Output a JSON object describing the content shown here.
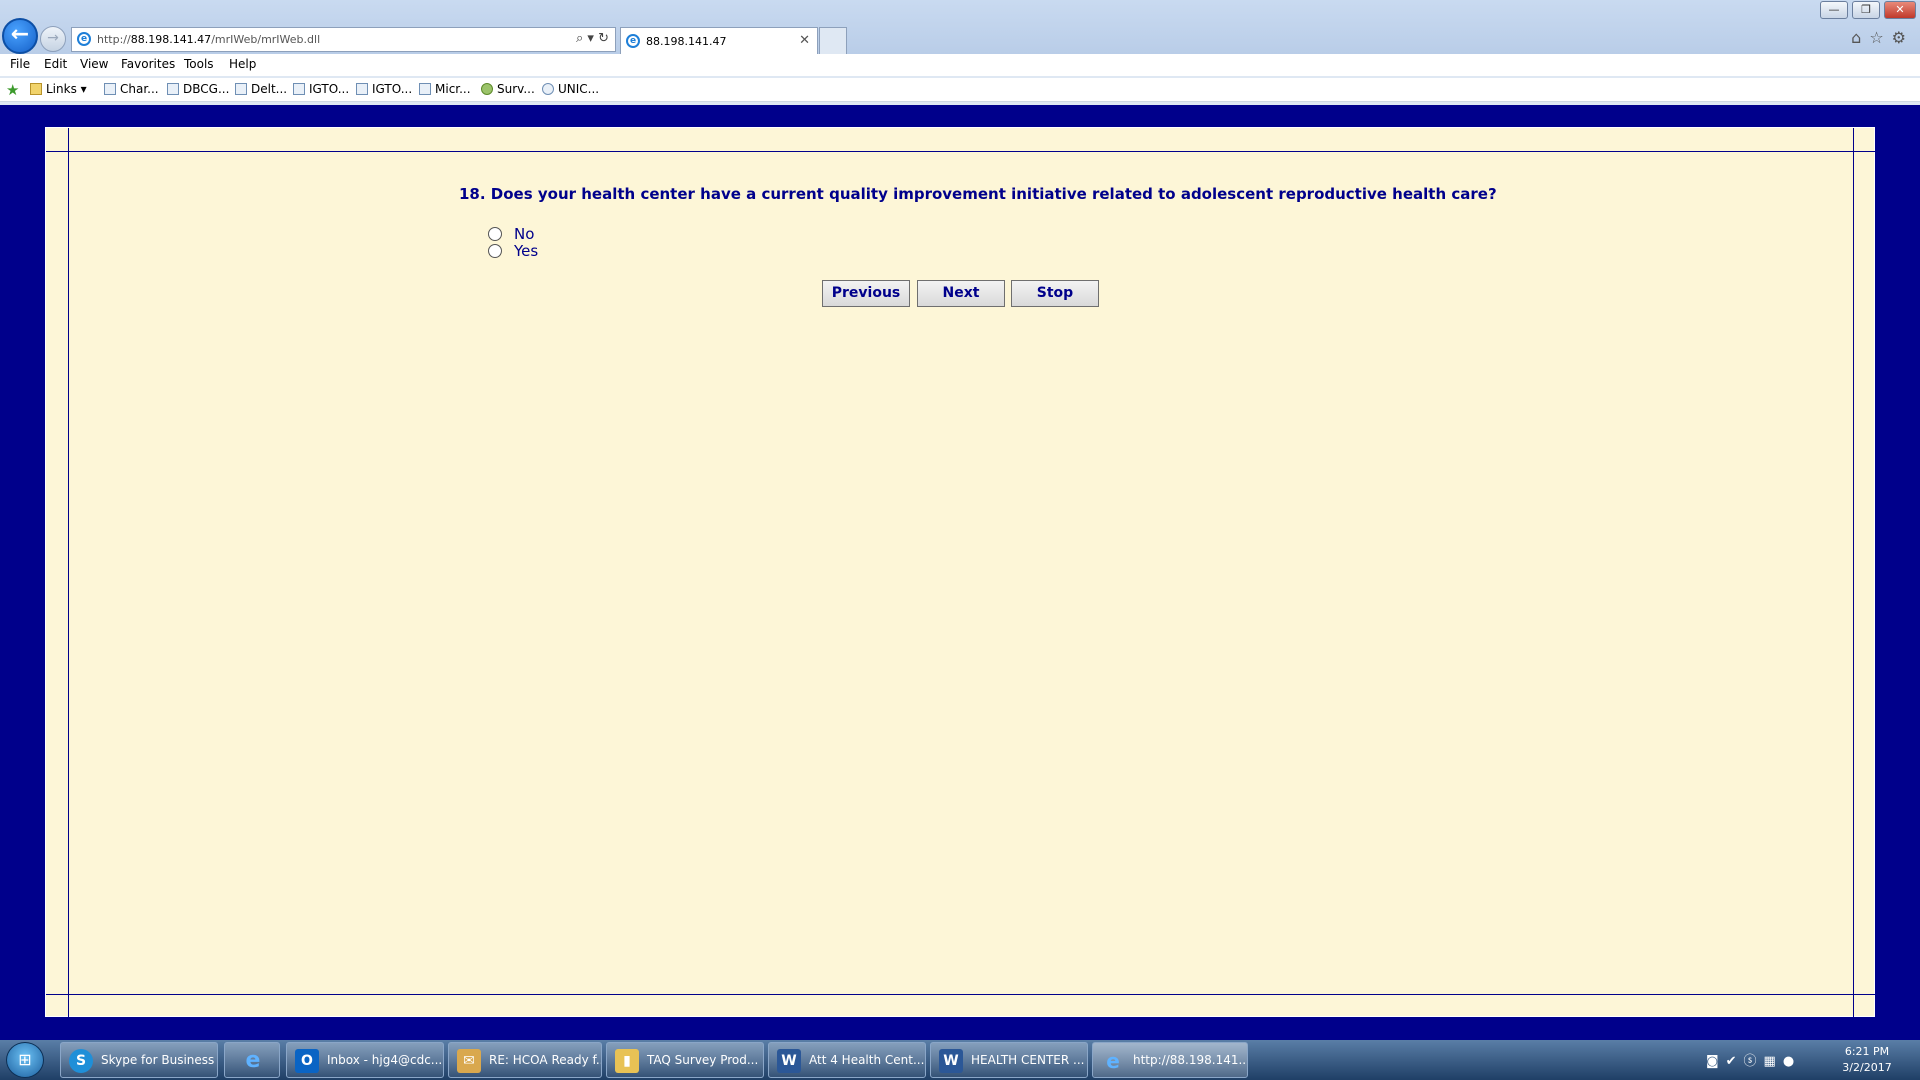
{
  "browser": {
    "url_prefix": "http://",
    "url_host": "88.198.141.47",
    "url_path": "/mrIWeb/mrIWeb.dll",
    "tab_title": "88.198.141.47",
    "window_buttons": [
      "—",
      "❐",
      "✕"
    ]
  },
  "menu": [
    "File",
    "Edit",
    "View",
    "Favorites",
    "Tools",
    "Help"
  ],
  "favorites": [
    {
      "label": "Links ▾"
    },
    {
      "label": "Char..."
    },
    {
      "label": "DBCG..."
    },
    {
      "label": "Delt..."
    },
    {
      "label": "IGTO..."
    },
    {
      "label": "IGTO..."
    },
    {
      "label": "Micr..."
    },
    {
      "label": "Surv..."
    },
    {
      "label": "UNIC..."
    }
  ],
  "survey": {
    "question": "18. Does your health center have a current quality improvement initiative related to adolescent reproductive health care?",
    "options": [
      "No",
      "Yes"
    ],
    "buttons": {
      "previous": "Previous",
      "next": "Next",
      "stop": "Stop"
    }
  },
  "taskbar": {
    "items": [
      {
        "label": "Skype for Business",
        "icon": "skype-icon",
        "color": "#1f8fd8"
      },
      {
        "label": "",
        "icon": "ie-icon",
        "color": "#1e7fd8"
      },
      {
        "label": "Inbox - hjg4@cdc...",
        "icon": "outlook-icon",
        "color": "#0a64c4"
      },
      {
        "label": "RE: HCOA Ready f...",
        "icon": "mail-icon",
        "color": "#d9a84e"
      },
      {
        "label": "TAQ Survey Prod...",
        "icon": "folder-icon",
        "color": "#e8c255"
      },
      {
        "label": "Att 4 Health Cent...",
        "icon": "word-icon",
        "color": "#2b5797"
      },
      {
        "label": "HEALTH CENTER ...",
        "icon": "word-icon",
        "color": "#2b5797"
      },
      {
        "label": "http://88.198.141....",
        "icon": "ie-icon",
        "color": "#1e7fd8"
      }
    ],
    "time": "6:21 PM",
    "date": "3/2/2017"
  }
}
